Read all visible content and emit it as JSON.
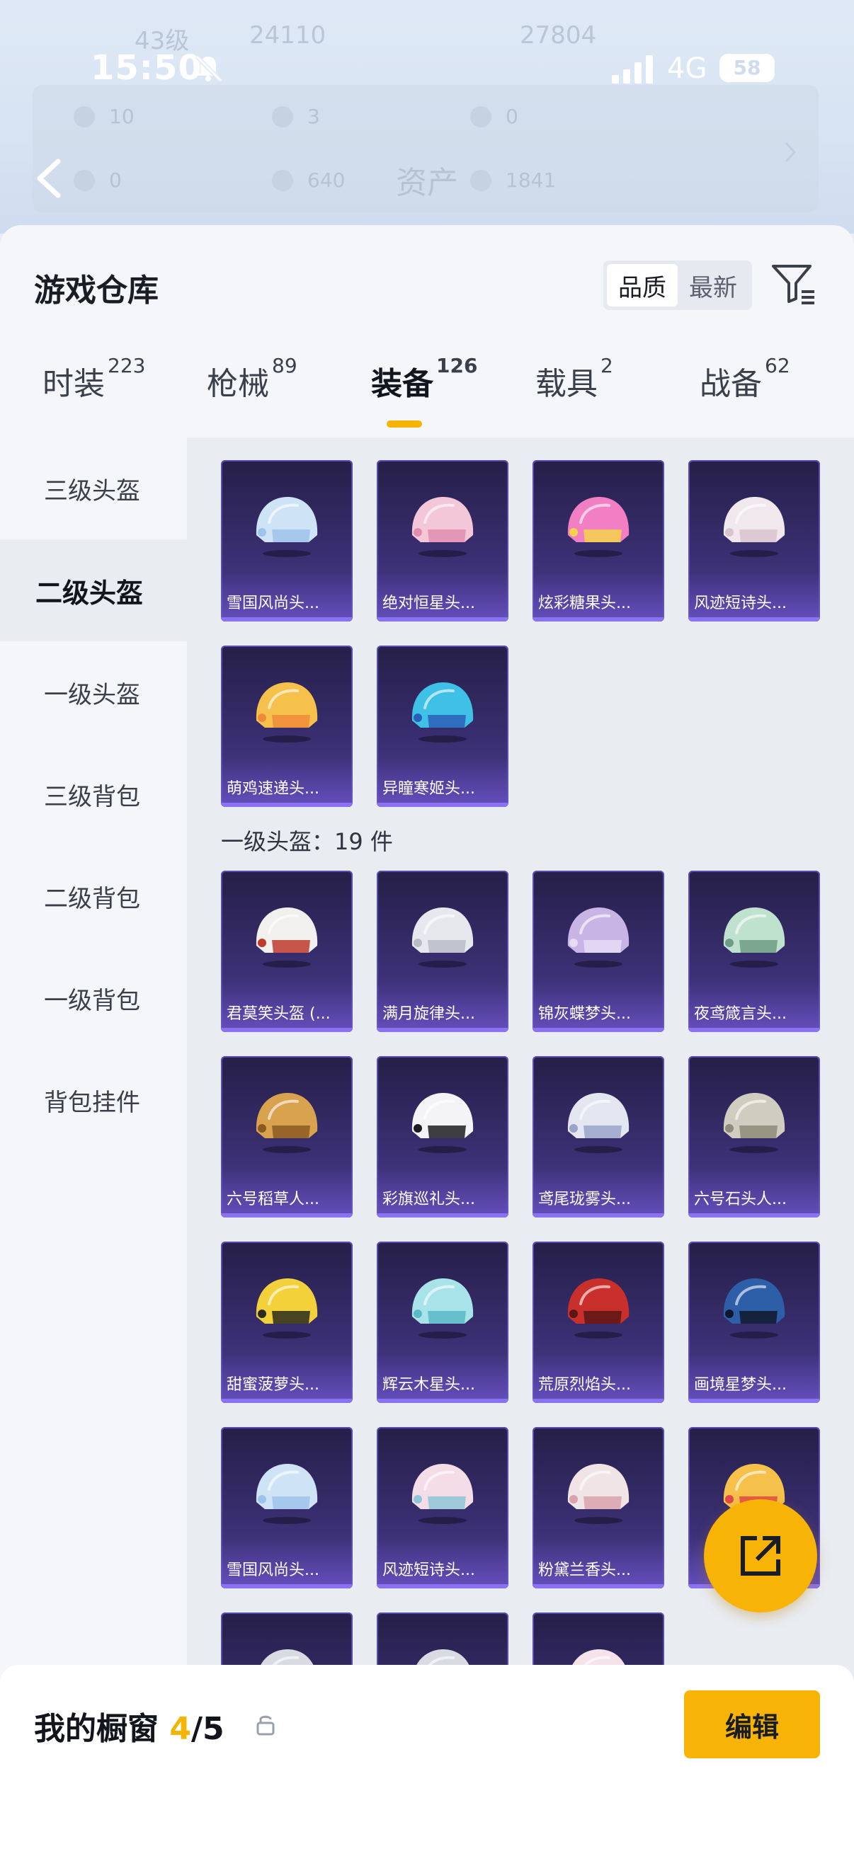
{
  "status_bar": {
    "time": "15:50",
    "network": "4G",
    "battery": "58"
  },
  "background_header": {
    "title": "资产",
    "ghost_level": "43级",
    "ghost_value_1": "24110",
    "ghost_value_2": "27804",
    "stats": [
      "10",
      "3",
      "0",
      "0",
      "640",
      "1841"
    ]
  },
  "sheet": {
    "title": "游戏仓库",
    "sort_options": [
      "品质",
      "最新"
    ],
    "active_sort": "品质"
  },
  "tabs": [
    {
      "label": "时装",
      "count": "223"
    },
    {
      "label": "枪械",
      "count": "89"
    },
    {
      "label": "装备",
      "count": "126",
      "active": true
    },
    {
      "label": "载具",
      "count": "2"
    },
    {
      "label": "战备",
      "count": "62"
    }
  ],
  "sidebar": {
    "items": [
      {
        "label": "三级头盔"
      },
      {
        "label": "二级头盔",
        "active": true
      },
      {
        "label": "一级头盔"
      },
      {
        "label": "三级背包"
      },
      {
        "label": "二级背包"
      },
      {
        "label": "一级背包"
      },
      {
        "label": "背包挂件"
      }
    ]
  },
  "level2_items": [
    {
      "name": "雪国风尚头...",
      "color": "#cfe3f7",
      "accent": "#9ec3ea"
    },
    {
      "name": "绝对恒星头...",
      "color": "#f3c6d8",
      "accent": "#e08db0"
    },
    {
      "name": "炫彩糖果头...",
      "color": "#f27fc4",
      "accent": "#f6d24a"
    },
    {
      "name": "风迹短诗头...",
      "color": "#f1e8ee",
      "accent": "#d9c3cf"
    },
    {
      "name": "萌鸡速递头...",
      "color": "#f6c14b",
      "accent": "#f08a3b"
    },
    {
      "name": "异瞳寒姬头...",
      "color": "#3fc0e6",
      "accent": "#2a5fb8"
    }
  ],
  "level1_section": {
    "label": "一级头盔：19 件"
  },
  "level1_items": [
    {
      "name": "君莫笑头盔 (...",
      "color": "#f2f0ee",
      "accent": "#c0392b"
    },
    {
      "name": "满月旋律头...",
      "color": "#e6e8ee",
      "accent": "#b8bcc8"
    },
    {
      "name": "锦灰蝶梦头...",
      "color": "#c9b4e6",
      "accent": "#e7dcf4"
    },
    {
      "name": "夜鸢箴言头...",
      "color": "#bfe2cf",
      "accent": "#6e9c86"
    },
    {
      "name": "六号稻草人...",
      "color": "#d9a24e",
      "accent": "#8a5a24"
    },
    {
      "name": "彩旗巡礼头...",
      "color": "#f4f4f6",
      "accent": "#1c1c22"
    },
    {
      "name": "鸢尾珑雾头...",
      "color": "#e3e6f0",
      "accent": "#9aa3c8"
    },
    {
      "name": "六号石头人...",
      "color": "#cfcdbf",
      "accent": "#8e8b7a"
    },
    {
      "name": "甜蜜菠萝头...",
      "color": "#f2d13a",
      "accent": "#2a2a1e"
    },
    {
      "name": "辉云木星头...",
      "color": "#a9e3ea",
      "accent": "#5bbac6"
    },
    {
      "name": "荒原烈焰头...",
      "color": "#c9302c",
      "accent": "#5a1614"
    },
    {
      "name": "画境星梦头...",
      "color": "#2d5fa8",
      "accent": "#10172c"
    },
    {
      "name": "雪国风尚头...",
      "color": "#cfe3f7",
      "accent": "#9ec3ea"
    },
    {
      "name": "风迹短诗头...",
      "color": "#f4dde6",
      "accent": "#8fc5d8"
    },
    {
      "name": "粉黛兰香头...",
      "color": "#f0e4e6",
      "accent": "#d8a3ab"
    },
    {
      "name": "",
      "color": "#f6c14b",
      "accent": "#e34848"
    },
    {
      "name": "",
      "color": "#d8dbe2",
      "accent": "#2a2d36"
    },
    {
      "name": "",
      "color": "#d8dbe2",
      "accent": "#3fa9e0"
    },
    {
      "name": "",
      "color": "#f6e2ea",
      "accent": "#f08cb0"
    }
  ],
  "bottom_bar": {
    "title": "我的橱窗",
    "current": "4",
    "total": "/5",
    "edit_label": "编辑"
  },
  "colors": {
    "accent": "#f8b406",
    "card_bg": "#3a2f72"
  }
}
